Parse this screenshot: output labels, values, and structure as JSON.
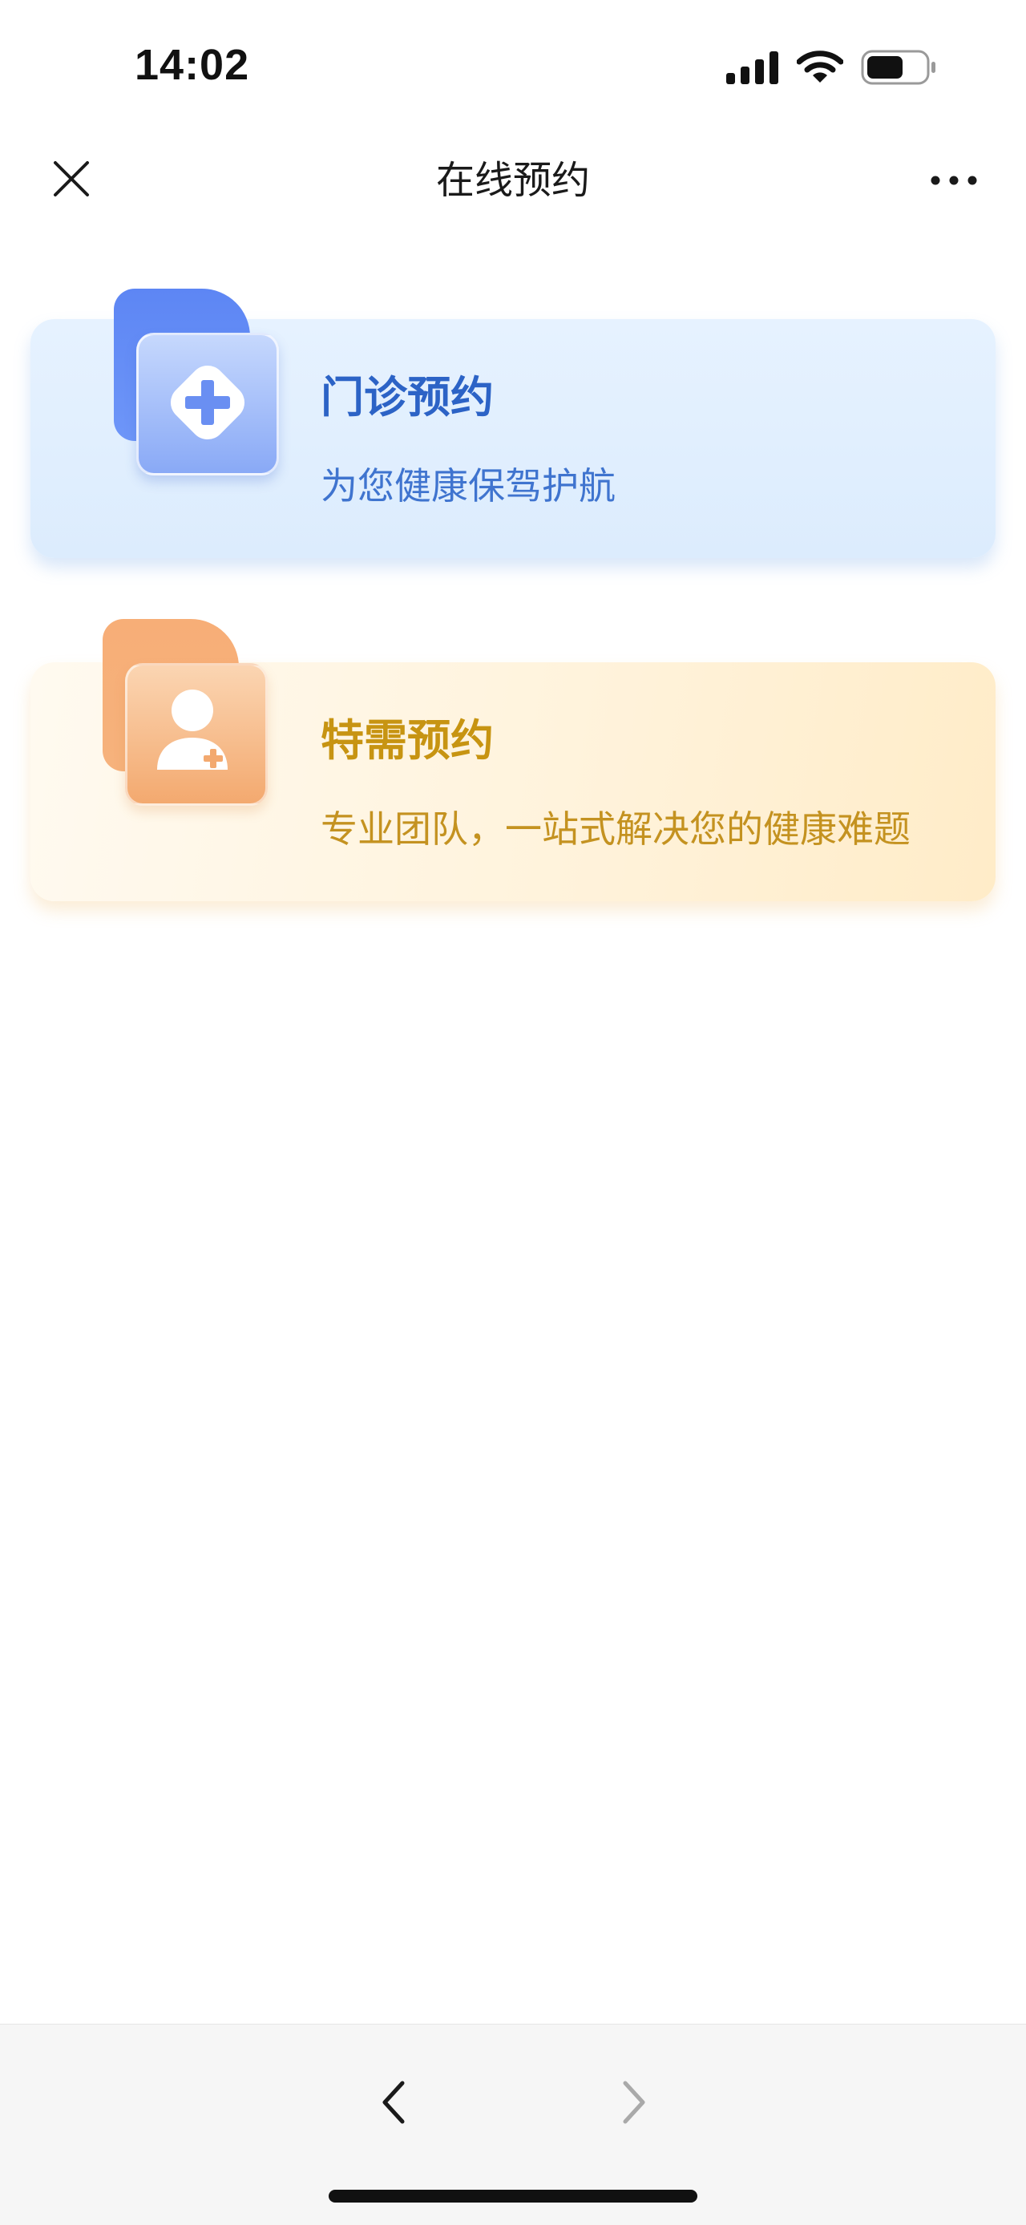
{
  "status_bar": {
    "time": "14:02",
    "icons": [
      "signal-icon",
      "wifi-icon",
      "battery-icon"
    ]
  },
  "nav_bar": {
    "title": "在线预约",
    "left_icon": "close-icon",
    "right_icon": "more-icon"
  },
  "cards": [
    {
      "title": "门诊预约",
      "subtitle": "为您健康保驾护航",
      "icon": "medical-cross-icon",
      "title_color": "#2c63c6",
      "accent_color": "#5d86f4"
    },
    {
      "title": "特需预约",
      "subtitle": "专业团队，一站式解决您的健康难题",
      "icon": "doctor-icon",
      "title_color": "#c79412",
      "accent_color": "#f7ae77"
    }
  ],
  "bottom_bar": {
    "back_icon": "chevron-left-icon",
    "forward_icon": "chevron-right-icon",
    "forward_enabled": false
  }
}
